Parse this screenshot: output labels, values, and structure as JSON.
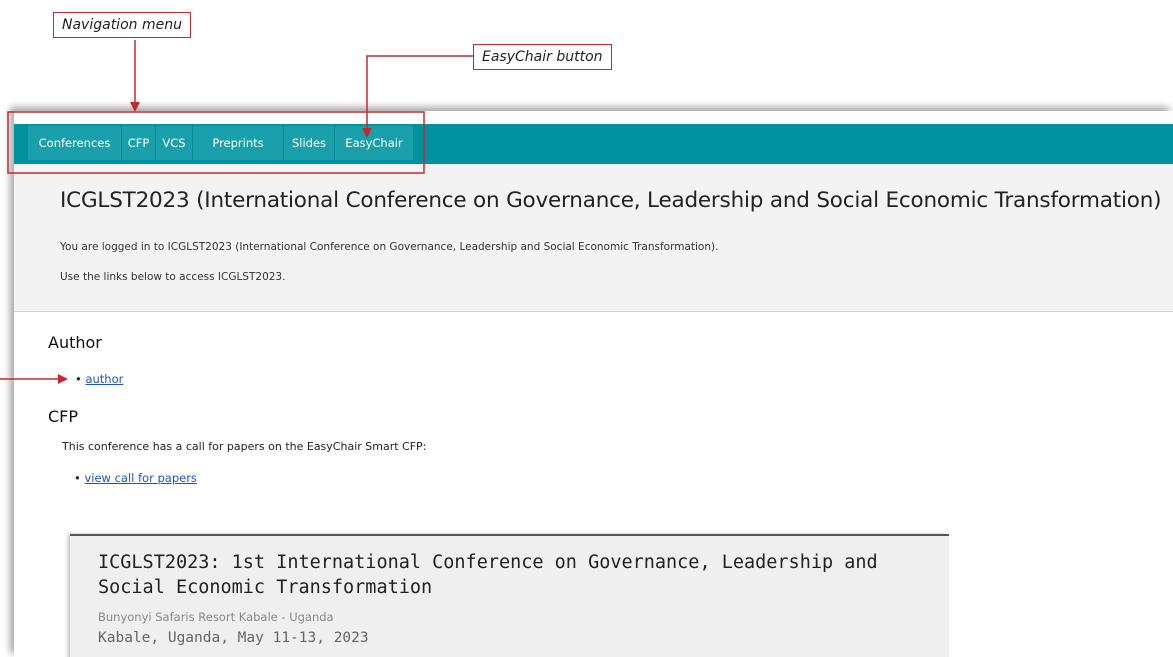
{
  "annotations": {
    "nav_menu_label": "Navigation menu",
    "easychair_label": "EasyChair button",
    "accent_color": "#c8282b"
  },
  "nav": {
    "items": [
      "Conferences",
      "CFP",
      "VCS",
      "Preprints",
      "Slides",
      "EasyChair"
    ],
    "bar_color": "#00939f"
  },
  "header": {
    "title": "ICGLST2023 (International Conference on Governance, Leadership and Social Economic Transformation)",
    "logged_in": "You are logged in to ICGLST2023 (International Conference on Governance, Leadership and Social Economic Transformation).",
    "use_links": "Use the links below to access ICGLST2023."
  },
  "author": {
    "heading": "Author",
    "link": "author"
  },
  "cfp": {
    "heading": "CFP",
    "text": "This conference has a call for papers on the EasyChair Smart CFP:",
    "link": "view call for papers"
  },
  "card": {
    "title": "ICGLST2023: 1st International Conference on Governance, Leadership and Social Economic Transformation",
    "venue": "Bunyonyi Safaris Resort Kabale - Uganda",
    "date": "Kabale, Uganda, May 11-13, 2023"
  }
}
